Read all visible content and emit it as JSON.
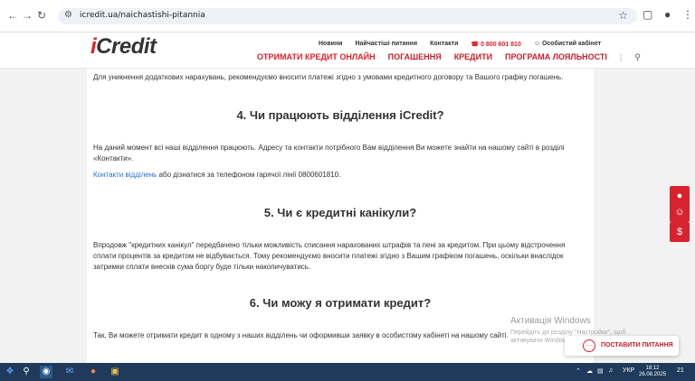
{
  "browser": {
    "url": "icredit.ua/naichastishi-pitannia"
  },
  "header": {
    "logo_i": "i",
    "logo_rest": "Credit",
    "top_links": [
      "Новини",
      "Найчастіші питання",
      "Контакти"
    ],
    "phone": "0 800 601 810",
    "account": "Особистий кабінет",
    "menu": [
      "ОТРИМАТИ КРЕДИТ ОНЛАЙН",
      "ПОГАШЕННЯ",
      "КРЕДИТИ",
      "ПРОГРАМА ЛОЯЛЬНОСТІ"
    ]
  },
  "content": {
    "intro": "Для уникнення додаткових нарахувань, рекомендуємо вносити платежі згідно з умовами кредитного договору та Вашого графіку погашень.",
    "q4_title": "4. Чи працюють відділення iCredit?",
    "q4_text": "На даний момент всі наші відділення працюють. Адресу та контакти потрібного Вам відділення Ви можете знайти на нашому сайті в розділі «Контакти».",
    "q4_link": "Контакти відділень",
    "q4_link_rest": " або дізнатися за телефоном гарячої лінії 0800601810.",
    "q5_title": "5. Чи є кредитні канікули?",
    "q5_text": "Впродовж \"кредитних канікул\" передбачено тільки можливість списання нарахованих штрафів та пені за кредитом. При цьому відстрочення сплати процентів за кредитом не відбувається. Тому рекомендуємо вносити платежі згідно з Вашим графіком погашень, оскільки внаслідок затримки сплати внесків сума боргу буде тільки накопичуватись.",
    "q6_title": "6. Чи можу я отримати кредит?",
    "q6_text": "Так, Ви можете отримати кредит в одному з наших відділень чи оформивши заявку в особистому кабінеті на нашому сайті."
  },
  "watermark": {
    "title": "Активація Windows",
    "subtitle": "Перейдіть до розділу \"Настройки\", щоб активувати Windows."
  },
  "ask_button": {
    "label": "ПОСТАВИТИ ПИТАННЯ"
  },
  "taskbar": {
    "lang": "УКР",
    "time": "18:12",
    "date": "26.08.2025",
    "notifications": "21"
  }
}
